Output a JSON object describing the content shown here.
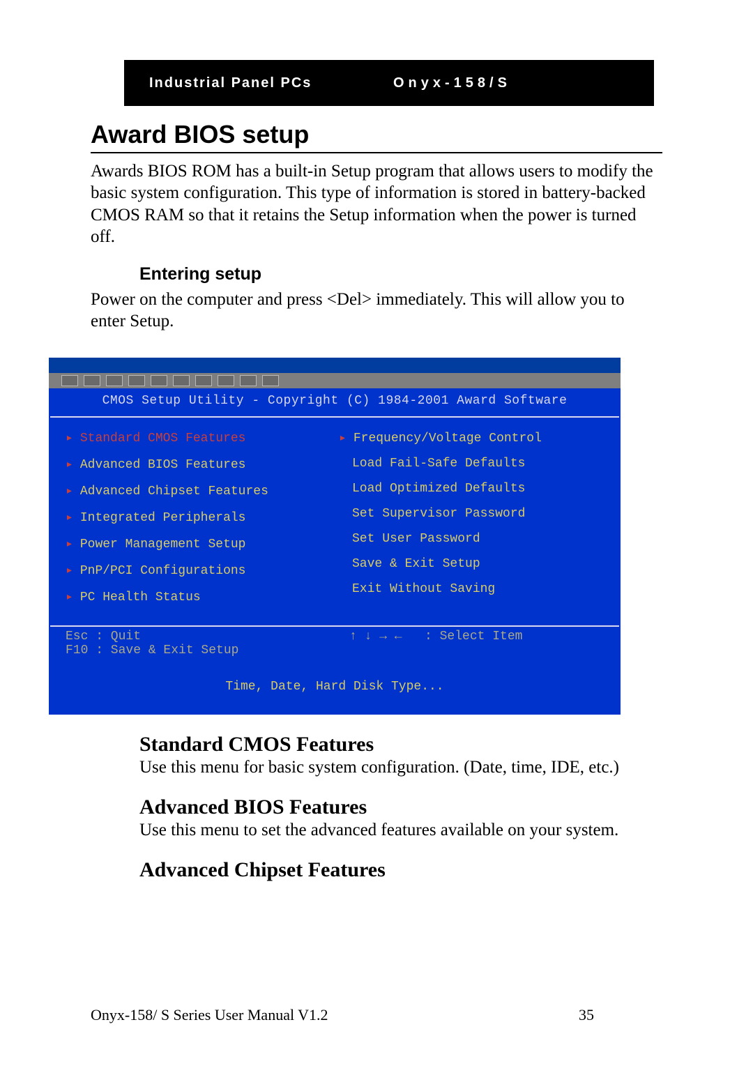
{
  "header": {
    "left": "Industrial Panel PCs",
    "right": "Onyx-158/S"
  },
  "title": "Award BIOS setup",
  "intro": "Awards BIOS ROM has a built-in Setup program that allows users to modify the basic system configuration. This type of information is stored in battery-backed CMOS RAM so that it retains the Setup information when the power is turned off.",
  "sub1": {
    "head": "Entering setup",
    "body": "Power on the computer and press <Del> immediately. This will allow you to enter Setup."
  },
  "bios": {
    "heading": "CMOS Setup Utility - Copyright (C) 1984-2001 Award Software",
    "left": [
      {
        "label": "Standard CMOS Features",
        "bullet": true,
        "selected": true
      },
      {
        "label": "Advanced BIOS Features",
        "bullet": true
      },
      {
        "label": "Advanced Chipset Features",
        "bullet": true
      },
      {
        "label": "Integrated Peripherals",
        "bullet": true
      },
      {
        "label": "Power Management Setup",
        "bullet": true
      },
      {
        "label": "PnP/PCI Configurations",
        "bullet": true
      },
      {
        "label": "PC Health Status",
        "bullet": true
      }
    ],
    "right": [
      {
        "label": "Frequency/Voltage Control",
        "bullet": true
      },
      {
        "label": "Load Fail-Safe Defaults",
        "bullet": false
      },
      {
        "label": "Load Optimized Defaults",
        "bullet": false
      },
      {
        "label": "Set Supervisor Password",
        "bullet": false
      },
      {
        "label": "Set User Password",
        "bullet": false
      },
      {
        "label": "Save & Exit Setup",
        "bullet": false
      },
      {
        "label": "Exit Without Saving",
        "bullet": false
      }
    ],
    "keys_left": "Esc : Quit\nF10 : Save & Exit Setup",
    "keys_right": "↑ ↓ → ←   : Select Item",
    "hint": "Time, Date, Hard Disk Type..."
  },
  "sections": [
    {
      "head": "Standard CMOS Features",
      "body": "Use this menu for basic system configuration. (Date, time, IDE, etc.)"
    },
    {
      "head": "Advanced BIOS Features",
      "body": "Use this menu to set the advanced features available on your system."
    },
    {
      "head": "Advanced Chipset Features",
      "body": ""
    }
  ],
  "footer": {
    "name": "Onyx-158/ S Series User Manual V1.2",
    "page": "35"
  }
}
